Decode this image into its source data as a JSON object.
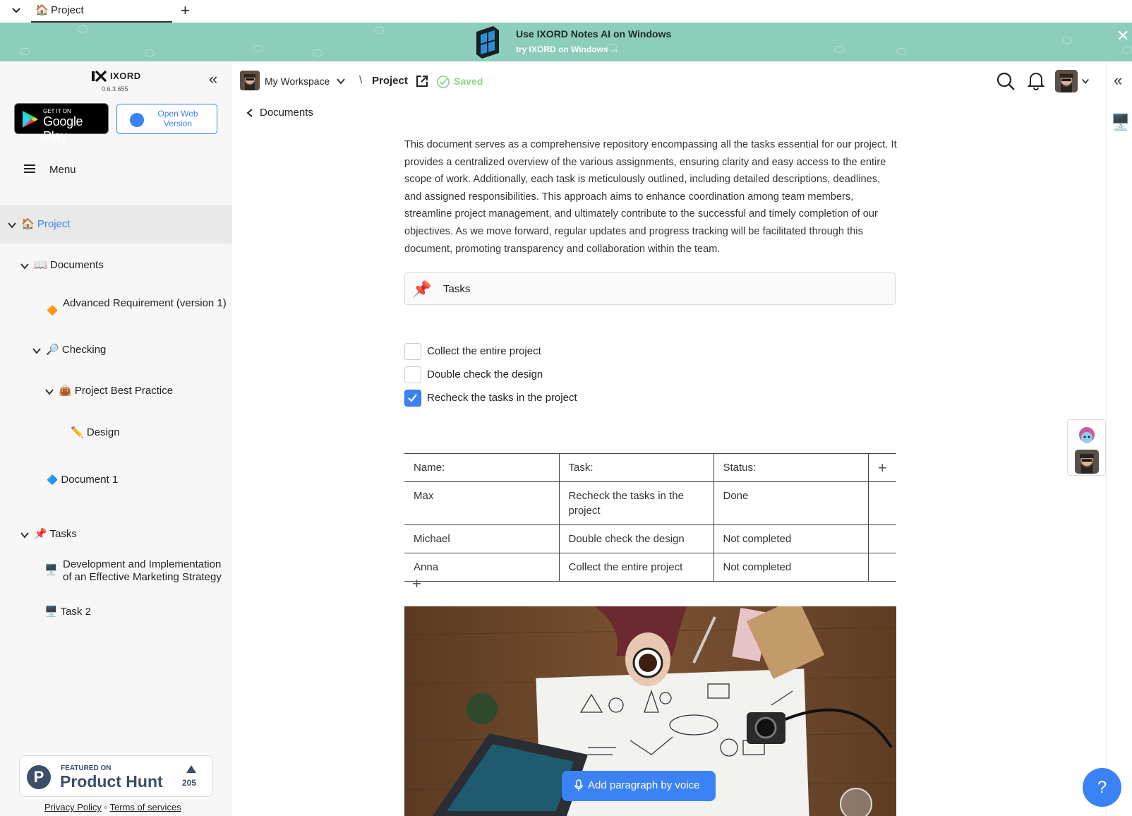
{
  "tabbar": {
    "tab_label": "Project",
    "tab_icon": "🏠",
    "new_tab": "+"
  },
  "banner": {
    "title": "Use IXORD Notes AI on Windows",
    "subtitle": "try IXORD on Windows →",
    "close": "✕",
    "bg": "#8ccdbb"
  },
  "sidebar": {
    "app_name": "IXORD",
    "version": "0.6.3.655",
    "collapse": "«",
    "gplay_small": "GET IT ON",
    "gplay_big": "Google Play",
    "web_version": "Open Web Version",
    "menu_label": "Menu",
    "tree": [
      {
        "icon": "🏠",
        "label": "Project"
      },
      {
        "icon": "📖",
        "label": "Documents"
      },
      {
        "icon": "🔶",
        "label": "Advanced Requirement (version 1)"
      },
      {
        "icon": "🔎",
        "label": "Checking"
      },
      {
        "icon": "👜",
        "label": "Project Best Practice"
      },
      {
        "icon": "✏️",
        "label": "Design"
      },
      {
        "icon": "🔷",
        "label": "Document 1"
      },
      {
        "icon": "📌",
        "label": "Tasks"
      },
      {
        "icon": "🖥️",
        "label": "Development and Implementation of an Effective Marketing Strategy"
      },
      {
        "icon": "🖥️",
        "label": "Task 2"
      }
    ],
    "producthunt": {
      "featured": "FEATURED ON",
      "name": "Product Hunt",
      "votes": "205",
      "letter": "P"
    },
    "privacy": "Privacy Policy",
    "terms": "Terms of services"
  },
  "topbar": {
    "workspace": "My Workspace",
    "separator": "\\",
    "project": "Project",
    "saved": "Saved",
    "collapse_right": "«"
  },
  "back": {
    "label": "Documents"
  },
  "document": {
    "paragraph": "This document serves as a comprehensive repository encompassing all the tasks essential for our project. It provides a centralized overview of the various assignments, ensuring clarity and easy access to the entire scope of work. Additionally, each task is meticulously outlined, including detailed descriptions, deadlines, and assigned responsibilities. This approach aims to enhance coordination among team members, streamline project management, and ultimately contribute to the successful and timely completion of our objectives. As we move forward, regular updates and progress tracking will be facilitated through this document, promoting transparency and collaboration within the team.",
    "callout": {
      "icon": "📌",
      "label": "Tasks"
    },
    "checklist": [
      {
        "label": "Collect the entire project",
        "checked": false
      },
      {
        "label": "Double check the design",
        "checked": false
      },
      {
        "label": "Recheck the tasks in the project",
        "checked": true
      }
    ],
    "table": {
      "headers": [
        "Name:",
        "Task:",
        "Status:"
      ],
      "rows": [
        [
          "Max",
          "Recheck the tasks in the project",
          "Done"
        ],
        [
          "Michael",
          "Double check the design",
          "Not completed"
        ],
        [
          "Anna",
          "Collect the entire project",
          "Not completed"
        ]
      ],
      "add_col": "+",
      "add_row": "+"
    }
  },
  "voice_button": "Add paragraph by voice",
  "help": "?",
  "colors": {
    "accent": "#3b82f6",
    "saved": "#8fd28f"
  }
}
